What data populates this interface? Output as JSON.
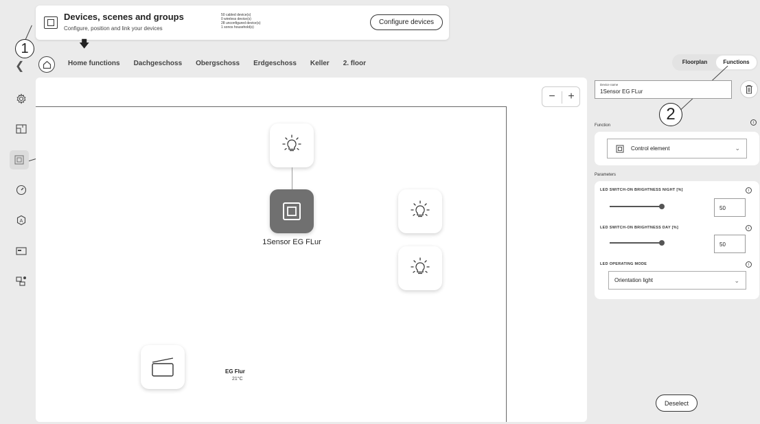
{
  "header_card": {
    "title": "Devices, scenes and groups",
    "subtitle": "Configure, position and link your devices",
    "counts": [
      "50 cabled device(s)",
      "0 wireless device(s)",
      "28 unconfigured device(s)",
      "1 sonos household(s)"
    ],
    "configure_label": "Configure devices"
  },
  "callouts": {
    "one": "1",
    "two": "2"
  },
  "nav": {
    "tabs": [
      "Home functions",
      "Dachgeschoss",
      "Obergschoss",
      "Erdgeschoss",
      "Keller",
      "2. floor"
    ],
    "view_toggle": {
      "floorplan": "Floorplan",
      "functions": "Functions",
      "selected": "Functions"
    }
  },
  "sidebar": {
    "icons": [
      "gear-icon",
      "floorplan-icon",
      "device-icon",
      "gauge-icon",
      "automation-icon",
      "display-icon",
      "network-icon"
    ],
    "active": "device-icon"
  },
  "canvas": {
    "zoom_out": "−",
    "zoom_in": "+",
    "selected_device_label": "1Sensor EG FLur",
    "room": {
      "name": "EG Flur",
      "temperature": "21°C"
    }
  },
  "panel": {
    "device_name_label": "Device name",
    "device_name_value": "1Sensor EG FLur",
    "function_label": "Function",
    "function_value": "Control element",
    "parameters_label": "Parameters",
    "params": {
      "night": {
        "label": "LED SWITCH-ON BRIGHTNESS NIGHT [%]",
        "value": "50",
        "slider_fraction": 0.5
      },
      "day": {
        "label": "LED SWITCH-ON BRIGHTNESS DAY [%]",
        "value": "50",
        "slider_fraction": 0.5
      },
      "mode": {
        "label": "LED OPERATING MODE",
        "value": "Orientation light"
      }
    },
    "info_glyph": "i",
    "deselect_label": "Deselect"
  },
  "colors": {
    "background": "#ebebeb",
    "selected_tile": "#707070"
  }
}
